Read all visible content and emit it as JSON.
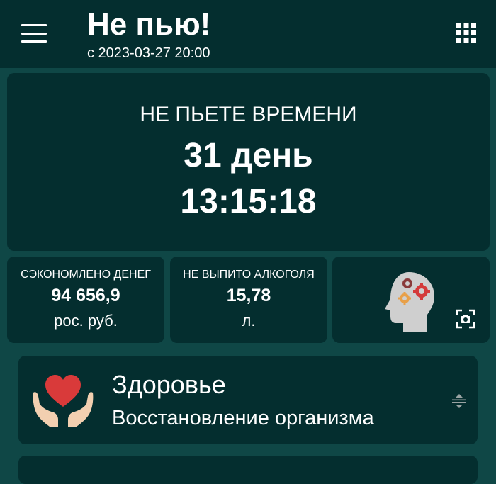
{
  "header": {
    "title": "Не пью!",
    "since": "с 2023-03-27 20:00",
    "menu_icon": "hamburger-menu-icon",
    "grid_icon": "apps-grid-icon"
  },
  "timer": {
    "label": "НЕ ПЬЕТЕ ВРЕМЕНИ",
    "days": "31 день",
    "time": "13:15:18"
  },
  "stats": [
    {
      "title": "СЭКОНОМЛЕНО ДЕНЕГ",
      "value": "94 656,9",
      "unit": "рос. руб."
    },
    {
      "title": "НЕ ВЫПИТО АЛКОГОЛЯ",
      "value": "15,78",
      "unit": "л."
    }
  ],
  "brain_card": {
    "icon": "head-gears-icon",
    "action_icon": "screenshot-camera-icon"
  },
  "health": {
    "title": "Здоровье",
    "subtitle": "Восстановление организма",
    "icon": "heart-in-hands-icon",
    "expand_icon": "expand-collapse-icon"
  },
  "colors": {
    "background": "#0f4746",
    "card": "#042e2f",
    "text": "#ffffff",
    "heart": "#d93a3a",
    "hands": "#f2cfb0",
    "head": "#cfcfcf",
    "gear_red": "#d43a3a",
    "gear_orange": "#e8a049",
    "gear_dark": "#8a3a3a"
  }
}
